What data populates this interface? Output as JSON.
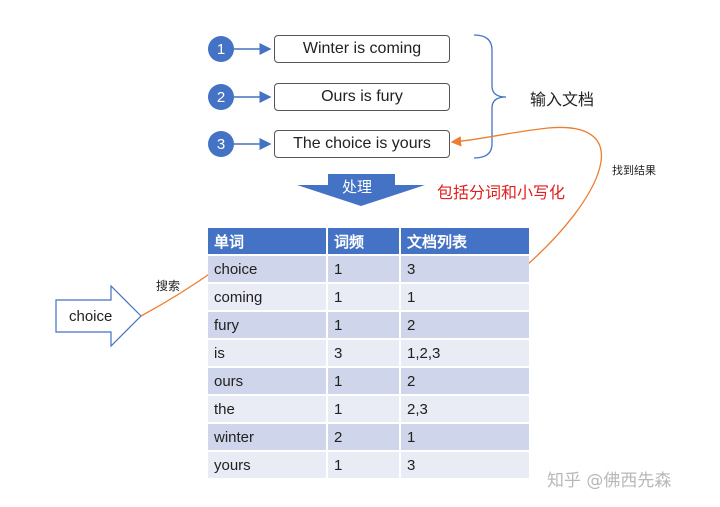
{
  "documents": [
    {
      "num": "1",
      "text": "Winter is coming"
    },
    {
      "num": "2",
      "text": "Ours is fury"
    },
    {
      "num": "3",
      "text": "The choice is yours"
    }
  ],
  "input_docs_label": "输入文档",
  "process_label": "处理",
  "process_note": "包括分词和小写化",
  "search_label": "搜索",
  "search_term": "choice",
  "found_label": "找到结果",
  "table": {
    "headers": [
      "单词",
      "词频",
      "文档列表"
    ],
    "rows": [
      [
        "choice",
        "1",
        "3"
      ],
      [
        "coming",
        "1",
        "1"
      ],
      [
        "fury",
        "1",
        "2"
      ],
      [
        "is",
        "3",
        "1,2,3"
      ],
      [
        "ours",
        "1",
        "2"
      ],
      [
        "the",
        "1",
        "2,3"
      ],
      [
        "winter",
        "2",
        "1"
      ],
      [
        "yours",
        "1",
        "3"
      ]
    ]
  },
  "watermark": "知乎 @佛西先森",
  "colors": {
    "accent_blue": "#4472c4",
    "note_red": "#e02020",
    "arrow_orange": "#ed7d31",
    "row_dark": "#cfd5ea",
    "row_light": "#e9ebf5"
  }
}
